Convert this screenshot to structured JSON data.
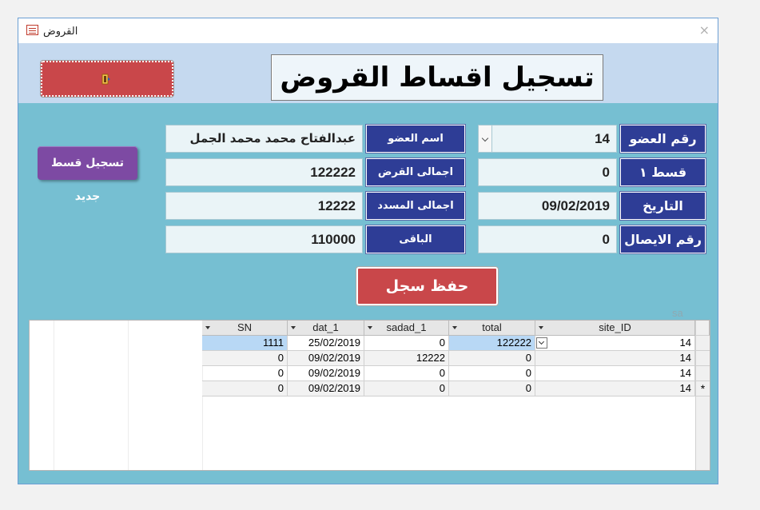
{
  "window": {
    "title": "القروض",
    "close_glyph": "×"
  },
  "form": {
    "title": "تسجيل اقساط القروض",
    "new_installment_button": "تسجيل قسط جديد",
    "save_button": "حفظ سجل",
    "corner_label": "sa"
  },
  "fields": {
    "member_no_label": "رقم العضو",
    "member_no_value": "14",
    "installment_label": "قسط ١",
    "installment_value": "0",
    "date_label": "التاريخ",
    "date_value": "09/02/2019",
    "receipt_no_label": "رقم الايصال",
    "receipt_no_value": "0",
    "member_name_label": "اسم العضو",
    "member_name_value": "عبدالفتاح محمد محمد الجمل",
    "loan_total_label": "اجمالى القرض",
    "loan_total_value": "122222",
    "paid_total_label": "اجمالى المسدد",
    "paid_total_value": "12222",
    "remaining_label": "الباقى",
    "remaining_value": "110000"
  },
  "grid": {
    "columns": [
      "SN",
      "dat_1",
      "sadad_1",
      "total",
      "site_ID"
    ],
    "rows": [
      [
        "1111",
        "25/02/2019",
        "0",
        "122222",
        "14"
      ],
      [
        "0",
        "09/02/2019",
        "12222",
        "0",
        "14"
      ],
      [
        "0",
        "09/02/2019",
        "0",
        "0",
        "14"
      ],
      [
        "0",
        "09/02/2019",
        "0",
        "0",
        "14"
      ]
    ],
    "new_row_marker": "*"
  },
  "colors": {
    "header_band": "#c5d9ef",
    "body": "#76bfd2",
    "label_bg": "#2e3d96",
    "red_button": "#c9474a",
    "purple_button": "#7d4aa3"
  },
  "icons": {
    "exit": "exit-door-icon",
    "form": "form-icon",
    "dropdown": "chevron-down-icon"
  }
}
